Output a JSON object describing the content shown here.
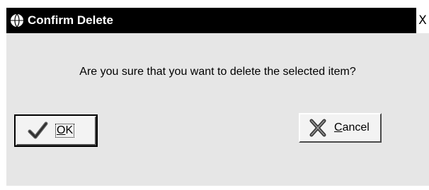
{
  "window": {
    "title": "Confirm Delete",
    "close_glyph": "X",
    "title_icon": "globe-icon"
  },
  "message": "Are you sure that you want to delete the selected item?",
  "buttons": {
    "ok": {
      "label_first": "O",
      "label_rest": "K",
      "icon": "checkmark-icon",
      "is_default": true
    },
    "cancel": {
      "label_first": "C",
      "label_rest": "ancel",
      "icon": "x-mark-icon"
    }
  }
}
